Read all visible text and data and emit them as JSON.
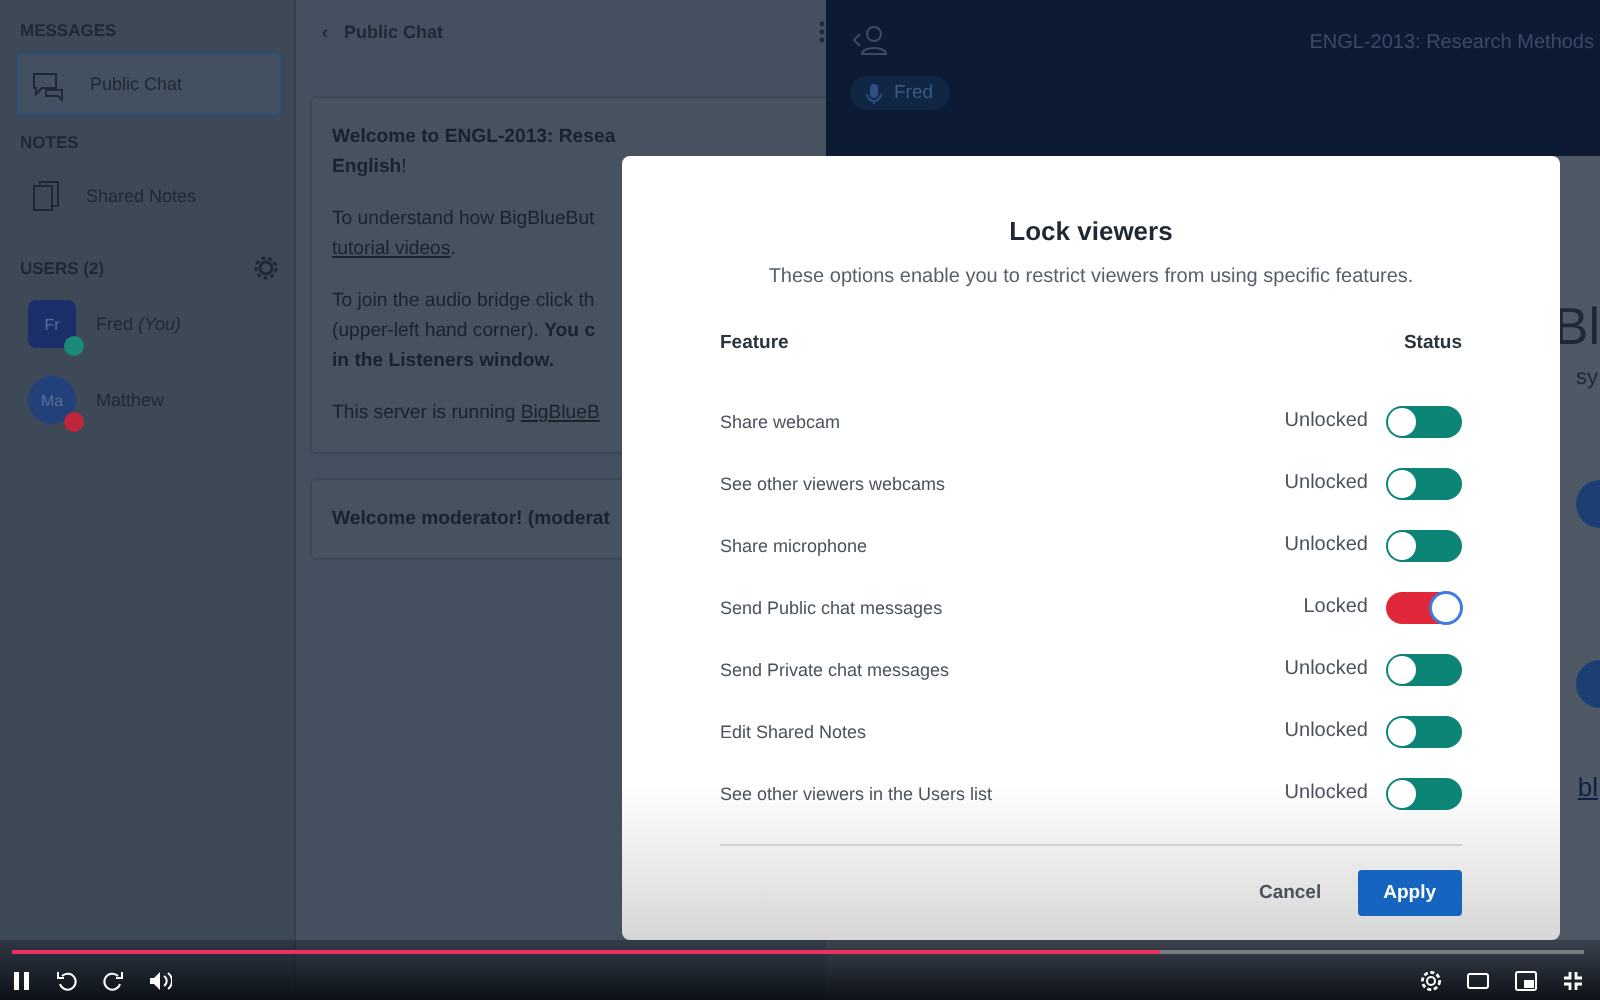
{
  "sidebar": {
    "messages": {
      "heading": "MESSAGES",
      "items": [
        {
          "label": "Public Chat",
          "selected": true
        }
      ]
    },
    "notes": {
      "heading": "NOTES",
      "items": [
        {
          "label": "Shared Notes",
          "selected": false
        }
      ]
    },
    "users": {
      "heading": "USERS (2)",
      "list": [
        {
          "initials": "Fr",
          "name": "Fred",
          "suffix": "(You)",
          "kind": "moderator",
          "color": "#1a8a7a"
        },
        {
          "initials": "Ma",
          "name": "Matthew",
          "kind": "viewer",
          "color": "#c0263a"
        }
      ]
    }
  },
  "chat": {
    "back": "‹",
    "title": "Public Chat",
    "messages": [
      {
        "paragraphs": [
          [
            [
              {
                "kind": "bold",
                "t": "Welcome to ENGL-2013: Resea"
              }
            ],
            [
              {
                "kind": "bold",
                "t": "English"
              },
              {
                "kind": "text",
                "t": "!"
              }
            ]
          ],
          [
            [
              {
                "kind": "text",
                "t": "To understand how BigBlueBut"
              }
            ],
            [
              {
                "kind": "link",
                "t": "tutorial videos"
              },
              {
                "kind": "text",
                "t": "."
              }
            ]
          ],
          [
            [
              {
                "kind": "text",
                "t": "To join the audio bridge click th"
              }
            ],
            [
              {
                "kind": "text",
                "t": "(upper-left hand corner). "
              },
              {
                "kind": "bold",
                "t": "You c"
              }
            ],
            [
              {
                "kind": "bold",
                "t": "in the Listeners window."
              }
            ]
          ],
          [
            [
              {
                "kind": "text",
                "t": "This server is running "
              },
              {
                "kind": "link",
                "t": "BigBlueB"
              }
            ]
          ]
        ]
      },
      {
        "paragraphs": [
          [
            [
              {
                "kind": "bold",
                "t": "Welcome moderator! (moderat"
              }
            ]
          ]
        ]
      }
    ]
  },
  "presentation": {
    "title": "ENGL-2013: Research Methods",
    "presenter": "Fred",
    "fragments": [
      "Bl",
      "sy",
      "bl"
    ]
  },
  "modal": {
    "title": "Lock viewers",
    "description": "These options enable you to restrict viewers from using specific features.",
    "columns": [
      "Feature",
      "Status"
    ],
    "rows": [
      {
        "feature": "Share webcam",
        "status": "Unlocked",
        "locked": false
      },
      {
        "feature": "See other viewers webcams",
        "status": "Unlocked",
        "locked": false
      },
      {
        "feature": "Share microphone",
        "status": "Unlocked",
        "locked": false
      },
      {
        "feature": "Send Public chat messages",
        "status": "Locked",
        "locked": true
      },
      {
        "feature": "Send Private chat messages",
        "status": "Unlocked",
        "locked": false
      },
      {
        "feature": "Edit Shared Notes",
        "status": "Unlocked",
        "locked": false
      },
      {
        "feature": "See other viewers in the Users list",
        "status": "Unlocked",
        "locked": false
      }
    ],
    "buttons": [
      {
        "label": "Cancel",
        "kind": "secondary"
      },
      {
        "label": "Apply",
        "kind": "primary"
      }
    ]
  },
  "player": {
    "progress": {
      "level": 0.73
    },
    "playing": true
  }
}
